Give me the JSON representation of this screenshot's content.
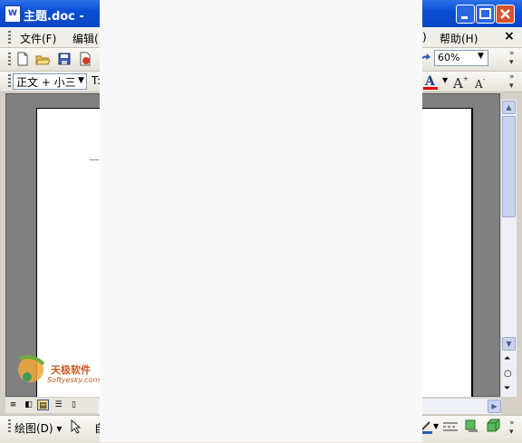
{
  "window": {
    "title": "主题.doc - ",
    "app_icon_letter": "W"
  },
  "menu": {
    "file": "文件(F)",
    "edit": "编辑(",
    "tools_partial": ")",
    "help": "帮助(H)",
    "close_glyph": "×"
  },
  "toolbar": {
    "zoom": "60%",
    "style": "正文 + 小三",
    "font_partial": "T:",
    "chevron": "»"
  },
  "drawing": {
    "label": "绘图(D) ▾",
    "autoshape_partial": "自"
  },
  "watermark": {
    "name": "天极软件",
    "site": "Softyesky.com"
  },
  "colors": {
    "titlebar": "#0a4fd6",
    "workspace": "#808080",
    "page": "#ffffff"
  }
}
